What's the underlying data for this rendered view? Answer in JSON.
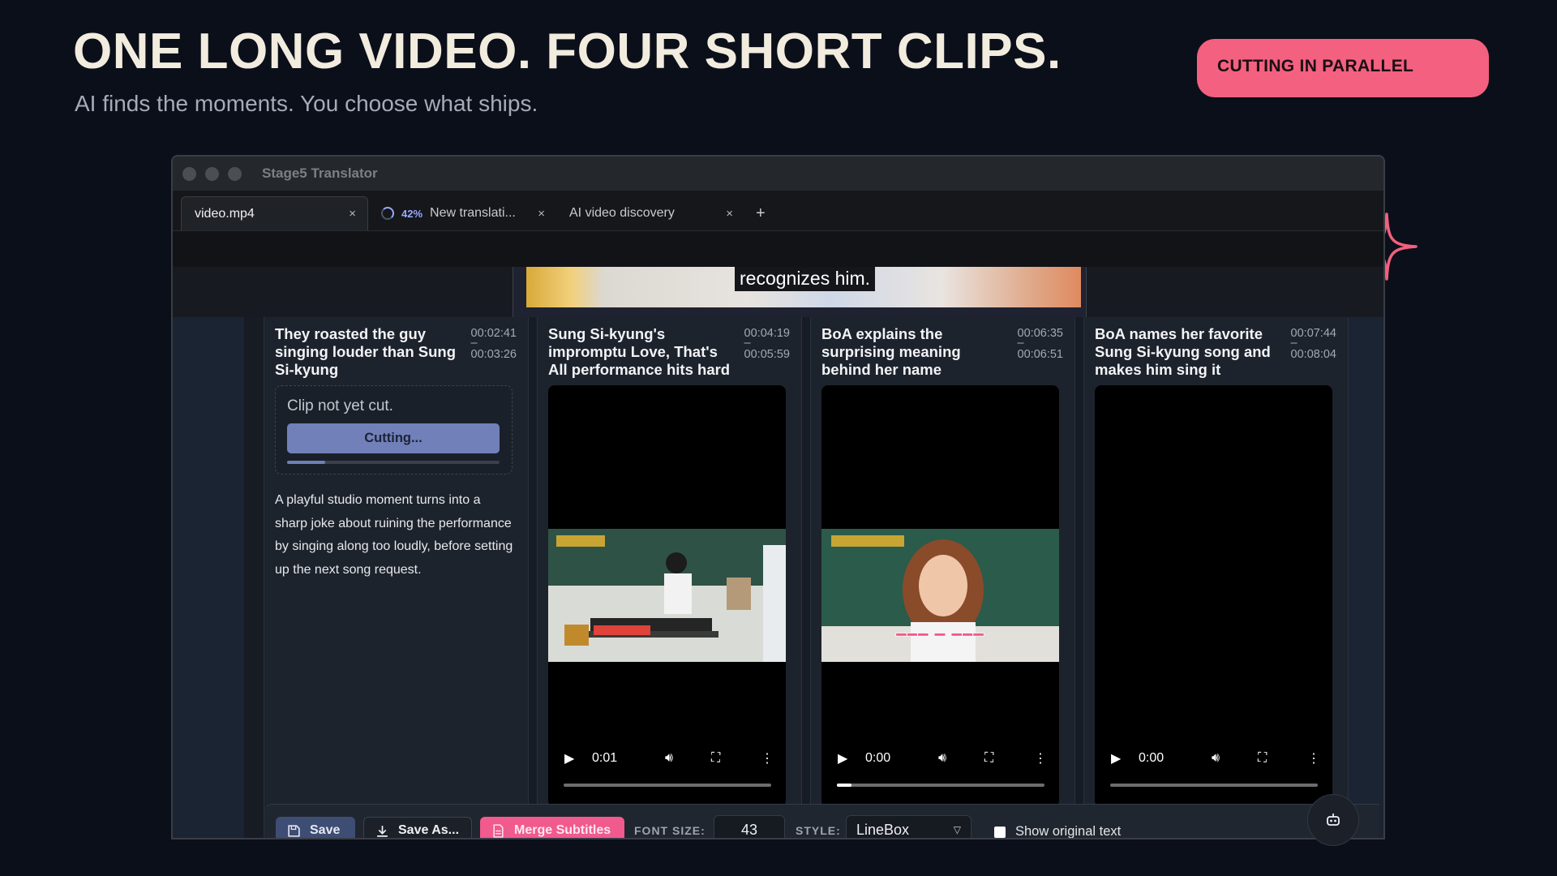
{
  "hero": {
    "headline": "ONE LONG VIDEO. FOUR SHORT CLIPS.",
    "subline": "AI finds the moments. You choose what ships.",
    "badge": "CUTTING IN PARALLEL",
    "accent_color": "#f4607f"
  },
  "window": {
    "title": "Stage5 Translator",
    "tabs": [
      {
        "label": "video.mp4",
        "close": "×",
        "active": true
      },
      {
        "progress": "42%",
        "label": "New translati...",
        "close": "×",
        "active": false
      },
      {
        "label": "AI video discovery",
        "close": "×",
        "active": false
      }
    ],
    "new_tab": "+"
  },
  "video": {
    "subtitle": "recognizes him."
  },
  "clips": [
    {
      "title": "They roasted the guy singing louder than Sung Si-kyung",
      "start": "00:02:41",
      "dash": "–",
      "end": "00:03:26",
      "status": "Clip not yet cut.",
      "cut_button": "Cutting...",
      "cut_progress": 0.18,
      "description": "A playful studio moment turns into a sharp joke about ruining the performance by singing along too loudly, before setting up the next song request."
    },
    {
      "title": "Sung Si-kyung's impromptu Love, That's All performance hits hard",
      "start": "00:04:19",
      "dash": "–",
      "end": "00:05:59",
      "player_time": "0:01",
      "progress": 0.0
    },
    {
      "title": "BoA explains the surprising meaning behind her name",
      "start": "00:06:35",
      "dash": "–",
      "end": "00:06:51",
      "player_time": "0:00",
      "progress": 0.07
    },
    {
      "title": "BoA names her favorite Sung Si-kyung song and makes him sing it",
      "start": "00:07:44",
      "dash": "–",
      "end": "00:08:04",
      "player_time": "0:00",
      "progress": 0.0
    }
  ],
  "toolbar": {
    "save": "Save",
    "save_as": "Save As...",
    "merge": "Merge Subtitles",
    "font_size_label": "FONT SIZE:",
    "font_size_value": "43",
    "style_label": "STYLE:",
    "style_value": "LineBox",
    "show_original": "Show original text"
  },
  "icons": {
    "play": "play-icon",
    "volume": "volume-icon",
    "fullscreen": "fullscreen-icon",
    "more": "more-vertical-icon",
    "robot": "robot-icon",
    "sparkle": "sparkle-icon"
  }
}
